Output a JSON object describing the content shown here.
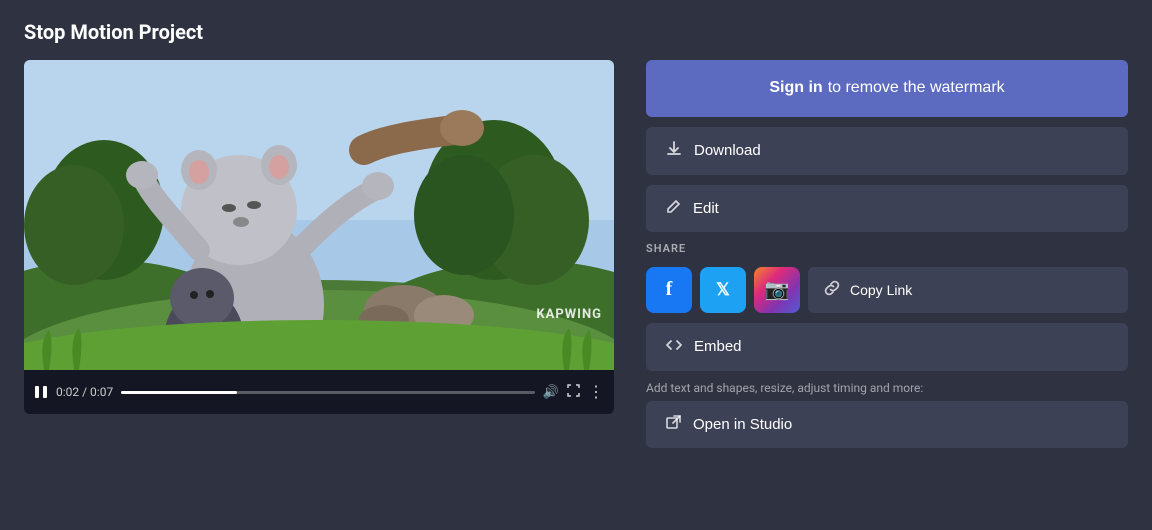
{
  "page": {
    "title": "Stop Motion Project",
    "background_color": "#2f3241"
  },
  "video": {
    "current_time": "0:02",
    "total_time": "0:07",
    "progress_percent": 28,
    "watermark": "KAPWING"
  },
  "actions": {
    "sign_in_bold": "Sign in",
    "sign_in_rest": "to remove the watermark",
    "download_label": "Download",
    "edit_label": "Edit",
    "copy_link_label": "Copy Link",
    "embed_label": "Embed",
    "open_studio_label": "Open in Studio",
    "studio_hint": "Add text and shapes, resize, adjust timing and more:",
    "share_label": "SHARE"
  },
  "social": {
    "facebook_letter": "f",
    "twitter_letter": "t",
    "instagram_letter": "ig"
  }
}
